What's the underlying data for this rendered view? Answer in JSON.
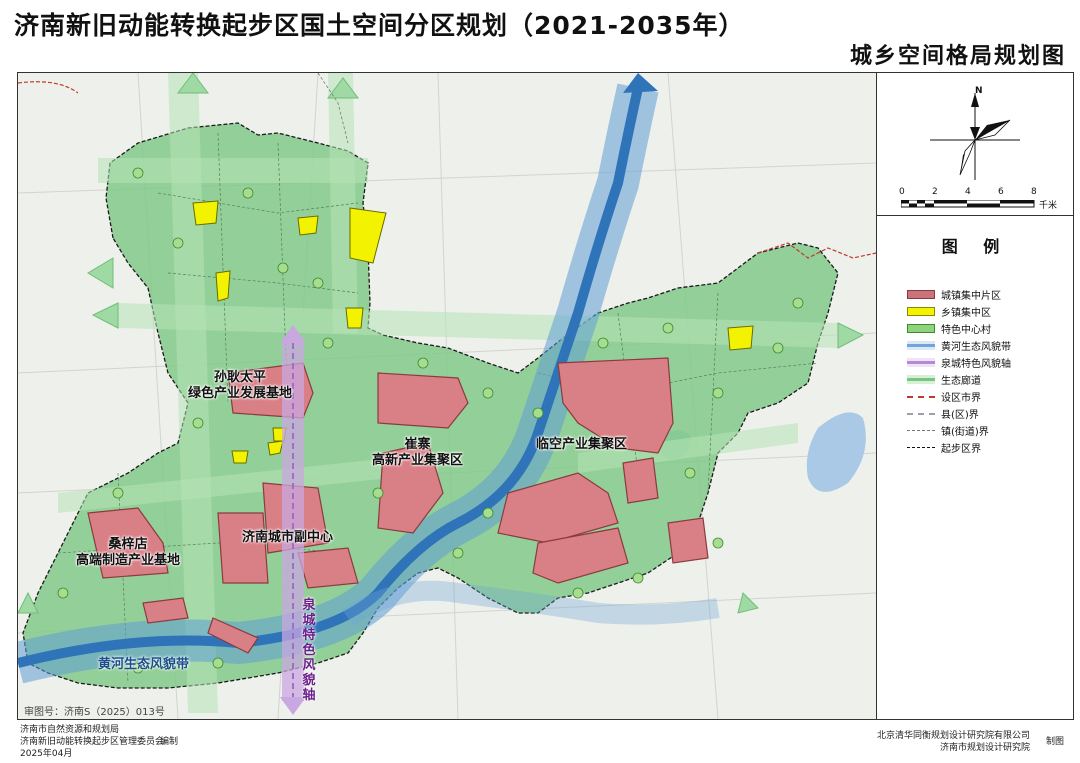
{
  "header": {
    "title": "济南新旧动能转换起步区国土空间分区规划（2021-2035年）",
    "subtitle": "城乡空间格局规划图"
  },
  "compass": {
    "north_label": "N"
  },
  "scale_bar": {
    "ticks": [
      "0",
      "2",
      "4",
      "6",
      "8"
    ],
    "unit": "千米"
  },
  "legend": {
    "title": "图 例",
    "items": [
      {
        "label": "城镇集中片区",
        "color": "#c9737a",
        "border": "#8a3b3f"
      },
      {
        "label": "乡镇集中区",
        "color": "#f3f200",
        "border": "#8a8a00"
      },
      {
        "label": "特色中心村",
        "color": "#8fd47a",
        "border": "#3f8a2f"
      },
      {
        "label": "黄河生态风貌带",
        "color": "#6fa5d8",
        "border": "#2f6aa8"
      },
      {
        "label": "泉城特色风貌轴",
        "color": "#c9a7e0",
        "border": "#7b4fa0"
      },
      {
        "label": "生态廊道",
        "color": "#9ed8a0",
        "border": "#4f9a52"
      },
      {
        "label": "设区市界",
        "color": "#ffffff",
        "border": "#c0392b"
      },
      {
        "label": "县(区)界",
        "color": "#ffffff",
        "border": "#9aa0b0"
      },
      {
        "label": "镇(街道)界",
        "color": "#ffffff",
        "border": "#777777"
      },
      {
        "label": "起步区界",
        "color": "#ffffff",
        "border": "#111111"
      }
    ]
  },
  "map_labels": {
    "sunyao": [
      "孙耿太平",
      "绿色产业发展基地"
    ],
    "cuizhai": [
      "崔寨",
      "高新产业集聚区"
    ],
    "linkong": "临空产业集聚区",
    "jinan_sub": "济南城市副中心",
    "sangzidian": [
      "桑梓店",
      "高端制造产业基地"
    ],
    "yellow_river": "黄河生态风貌带",
    "quancheng_axis": "泉城特色风貌轴"
  },
  "approval_no": "审图号：济南S（2025）013号",
  "footer": {
    "left": [
      "济南市自然资源和规划局",
      "济南新旧动能转换起步区管理委员会",
      "2025年04月"
    ],
    "left_action": "编制",
    "right": [
      "北京清华同衡规划设计研究院有限公司",
      "济南市规划设计研究院"
    ],
    "right_action": "制图"
  },
  "colors": {
    "zone_fill": "#82c98a",
    "base_map": "#eef0ec",
    "river": "#4f8fc9",
    "urban": "#c9737a",
    "township": "#f3f200"
  }
}
